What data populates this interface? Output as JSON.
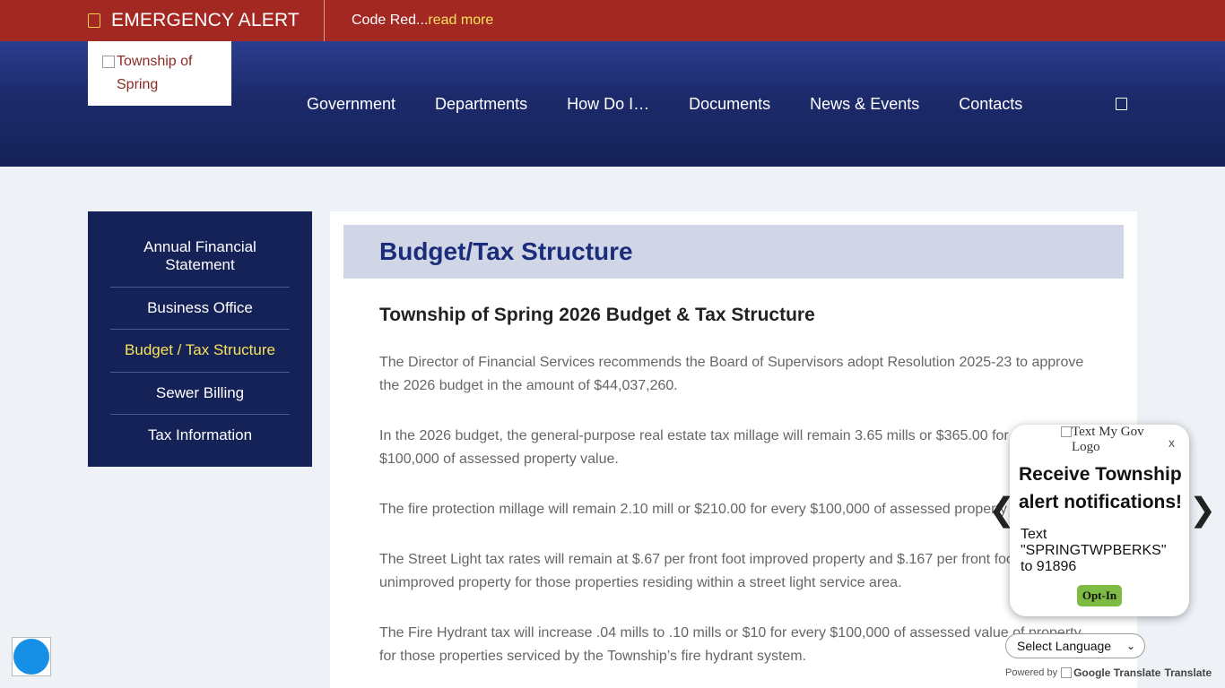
{
  "alert": {
    "title": "EMERGENCY ALERT",
    "message": "Code Red...",
    "link": "read more"
  },
  "header": {
    "logo_alt": "Township of Spring",
    "nav": [
      "Government",
      "Departments",
      "How Do I…",
      "Documents",
      "News & Events",
      "Contacts"
    ]
  },
  "sidebar": {
    "items": [
      {
        "label": "Annual Financial Statement"
      },
      {
        "label": "Business Office"
      },
      {
        "label": "Budget / Tax Structure"
      },
      {
        "label": "Sewer Billing"
      },
      {
        "label": "Tax Information"
      }
    ],
    "active_color": "#f6e35a"
  },
  "main": {
    "title": "Budget/Tax Structure",
    "section_title": "Township of Spring 2026 Budget & Tax Structure",
    "paragraphs": [
      "The Director of Financial Services recommends the Board of Supervisors adopt Resolution 2025-23 to approve the 2026 budget in the amount of $44,037,260.",
      "In the 2026 budget, the general-purpose real estate tax millage will remain 3.65 mills or $365.00 for every $100,000 of assessed property value.",
      "The fire protection millage will remain 2.10 mill or $210.00 for every $100,000 of assessed property value.",
      "The Street Light tax rates will remain at $.67 per front foot improved property and $.167 per front foot unimproved property for those properties residing within a street light service area.",
      "The Fire Hydrant tax will increase .04 mills to .10 mills or $10 for every $100,000 of assessed value of property for those properties serviced by the Township’s fire hydrant system."
    ]
  },
  "textmygov": {
    "logo_alt": "Text My Gov Logo",
    "close": "x",
    "heading": "Receive Township alert notifications!",
    "text": "Text \"SPRINGTWPBERKS\" to 91896",
    "button": "Opt-In",
    "prev": "❮",
    "next": "❯"
  },
  "translate": {
    "select": "Select Language",
    "powered_by": "Powered by",
    "google_alt": "Google Translate",
    "translate": "Translate"
  },
  "colors": {
    "alert_bg": "#a32822",
    "header_bg": "#1c2a6b",
    "accent_yellow": "#f6e35a",
    "title_blue": "#1b2d7a"
  }
}
